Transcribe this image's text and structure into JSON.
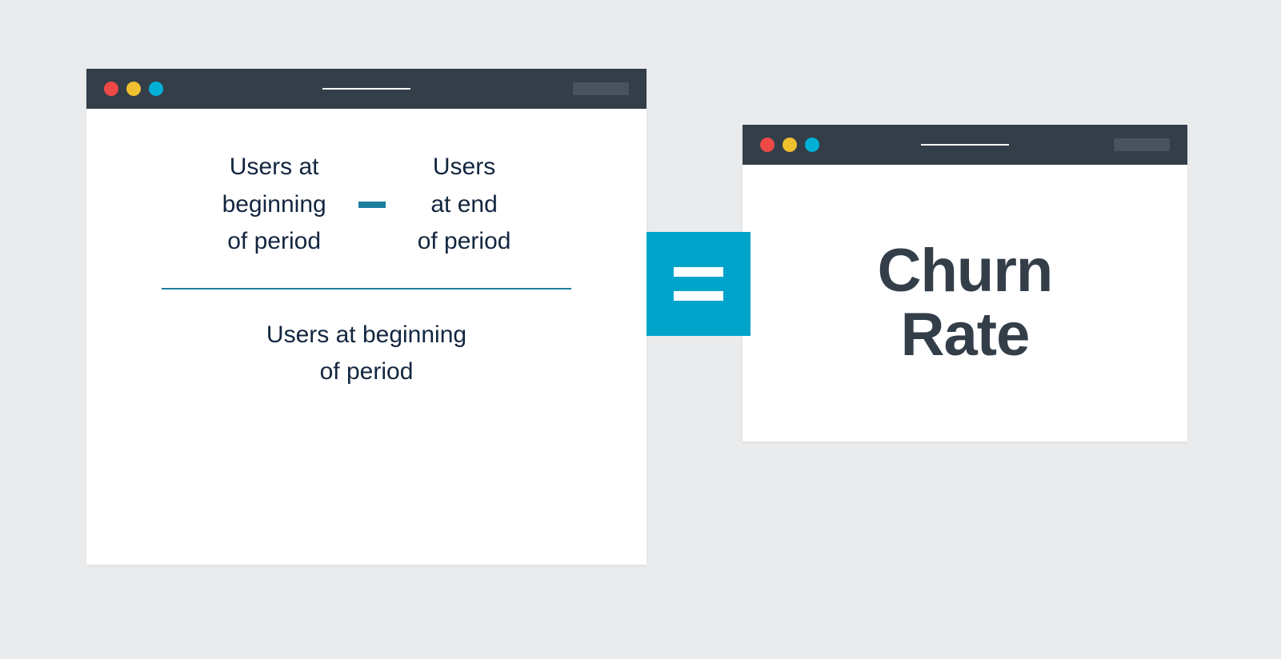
{
  "colors": {
    "background": "#e9ebec",
    "titlebar": "#333e49",
    "titlebarPill": "#48535e",
    "accent": "#00a4ca",
    "accentDark": "#1b7f9e",
    "text": "#12263f",
    "resultText": "#333e49",
    "trafficRed": "#ed4947",
    "trafficYellow": "#f0c02e",
    "trafficBlue": "#00b0d7"
  },
  "formula": {
    "numerator_left_line1": "Users at",
    "numerator_left_line2": "beginning",
    "numerator_left_line3": "of period",
    "operator": "minus",
    "numerator_right_line1": "Users",
    "numerator_right_line2": "at end",
    "numerator_right_line3": "of period",
    "denominator_line1": "Users at beginning",
    "denominator_line2": "of period"
  },
  "equals_symbol": "equals",
  "result": {
    "line1": "Churn",
    "line2": "Rate"
  }
}
